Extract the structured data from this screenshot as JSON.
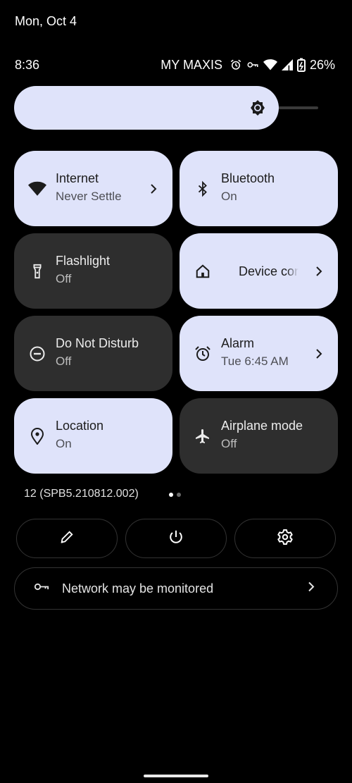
{
  "date": "Mon, Oct 4",
  "status": {
    "time": "8:36",
    "carrier": "MY MAXIS",
    "battery": "26%",
    "icons": [
      "alarm-icon",
      "vpn-key-icon",
      "wifi-icon",
      "signal-icon",
      "battery-icon"
    ]
  },
  "brightness": {
    "level": 0.87
  },
  "tiles": [
    {
      "id": "internet",
      "title": "Internet",
      "subtitle": "Never Settle",
      "state": "on",
      "icon": "wifi-icon",
      "chevron": true
    },
    {
      "id": "bluetooth",
      "title": "Bluetooth",
      "subtitle": "On",
      "state": "on",
      "icon": "bluetooth-icon",
      "chevron": false
    },
    {
      "id": "flashlight",
      "title": "Flashlight",
      "subtitle": "Off",
      "state": "off",
      "icon": "flashlight-icon",
      "chevron": false
    },
    {
      "id": "device-controls",
      "title": "Device controls",
      "subtitle": "",
      "state": "on",
      "icon": "home-icon",
      "chevron": true
    },
    {
      "id": "dnd",
      "title": "Do Not Disturb",
      "subtitle": "Off",
      "state": "off",
      "icon": "do-not-disturb-icon",
      "chevron": false
    },
    {
      "id": "alarm",
      "title": "Alarm",
      "subtitle": "Tue 6:45 AM",
      "state": "on",
      "icon": "alarm-icon",
      "chevron": true
    },
    {
      "id": "location",
      "title": "Location",
      "subtitle": "On",
      "state": "on",
      "icon": "location-pin-icon",
      "chevron": false
    },
    {
      "id": "airplane",
      "title": "Airplane mode",
      "subtitle": "Off",
      "state": "off",
      "icon": "airplane-icon",
      "chevron": false
    }
  ],
  "build": "12 (SPB5.210812.002)",
  "pages": {
    "current": 1,
    "total": 2
  },
  "actions": [
    "edit-icon",
    "power-icon",
    "settings-icon"
  ],
  "network": {
    "label": "Network may be monitored"
  },
  "colors": {
    "tile_on": "#dfe3fa",
    "tile_off": "#2e2e2e",
    "background": "#000000"
  }
}
